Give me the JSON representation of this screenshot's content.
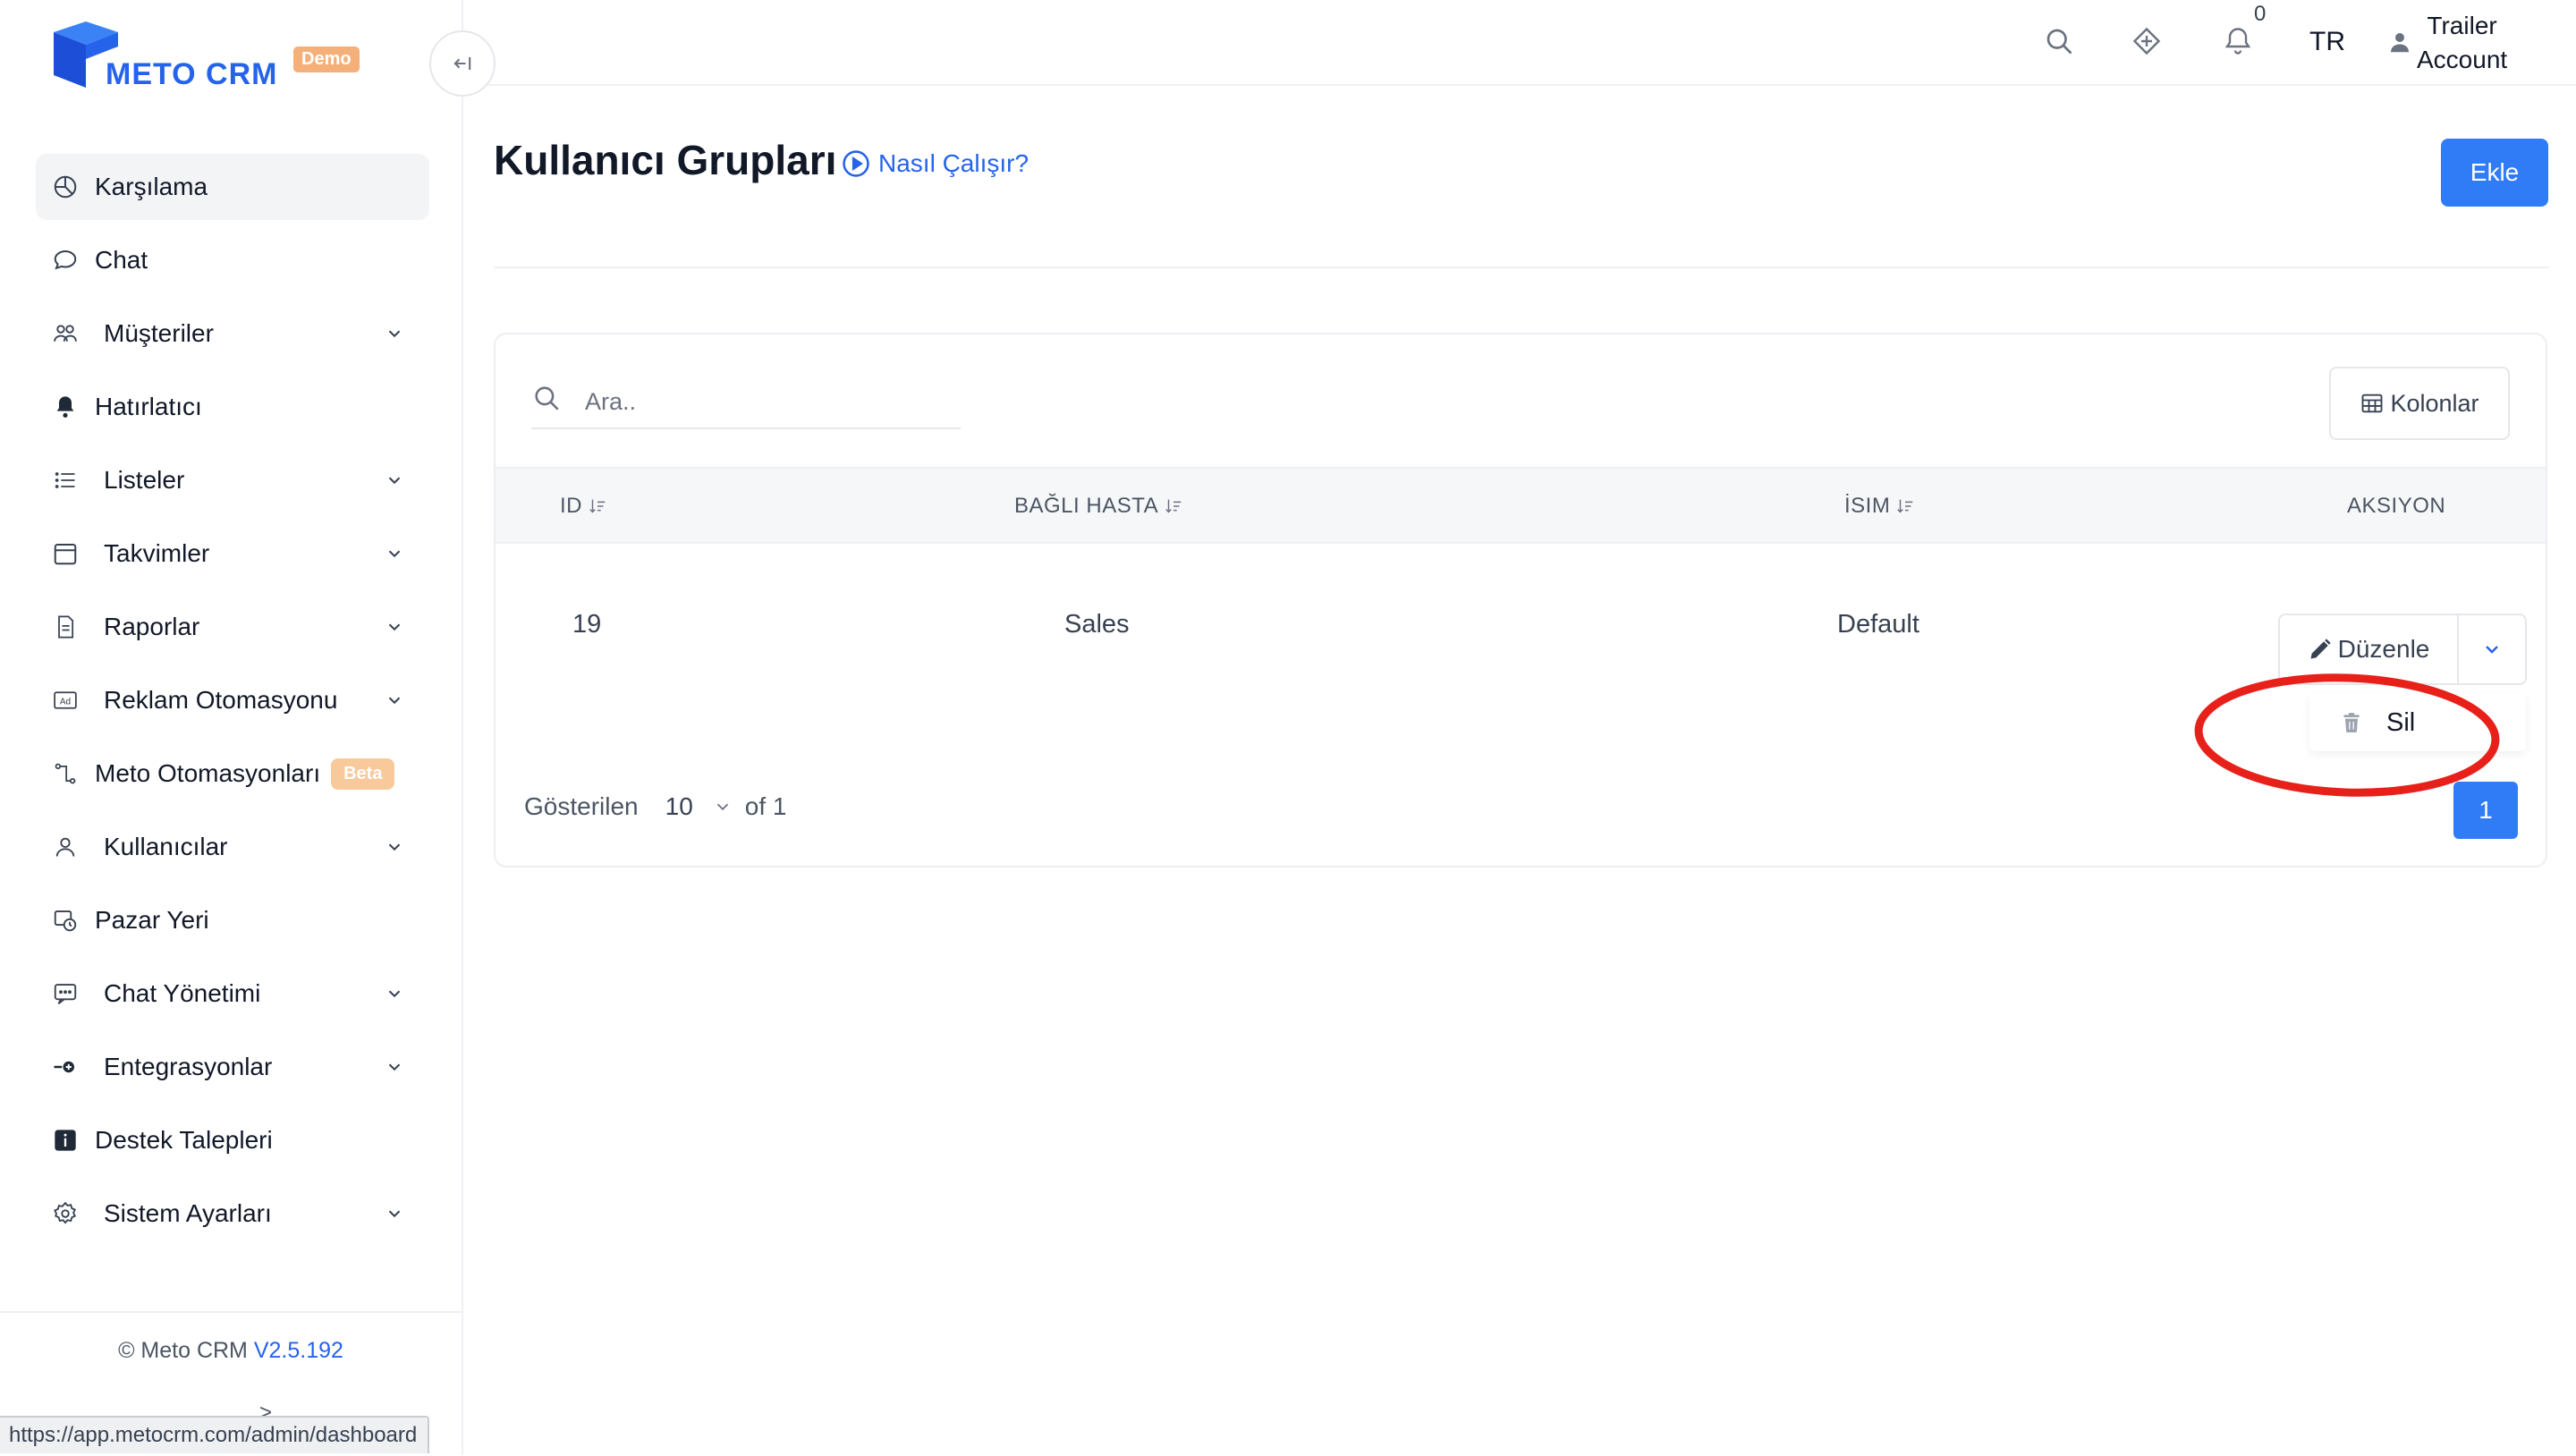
{
  "brand": {
    "name": "METO CRM",
    "badge": "Demo",
    "brand_color": "#2563eb"
  },
  "sidebar": {
    "items": [
      {
        "label": "Karşılama",
        "icon": "dashboard-icon",
        "active": true
      },
      {
        "label": "Chat",
        "icon": "chat-bubble-icon"
      },
      {
        "label": "Müşteriler",
        "icon": "users-icon",
        "submenu": true
      },
      {
        "label": "Hatırlatıcı",
        "icon": "bell-icon"
      },
      {
        "label": "Listeler",
        "icon": "list-icon",
        "submenu": true
      },
      {
        "label": "Takvimler",
        "icon": "calendar-icon",
        "submenu": true
      },
      {
        "label": "Raporlar",
        "icon": "report-icon",
        "submenu": true
      },
      {
        "label": "Reklam Otomasyonu",
        "icon": "ad-icon",
        "submenu": true
      },
      {
        "label": "Meto Otomasyonları",
        "icon": "automation-icon",
        "badge": "Beta"
      },
      {
        "label": "Kullanıcılar",
        "icon": "user-icon",
        "submenu": true
      },
      {
        "label": "Pazar Yeri",
        "icon": "marketplace-icon"
      },
      {
        "label": "Chat Yönetimi",
        "icon": "chat-manage-icon",
        "submenu": true
      },
      {
        "label": "Entegrasyonlar",
        "icon": "integration-icon",
        "submenu": true
      },
      {
        "label": "Destek Talepleri",
        "icon": "info-icon"
      },
      {
        "label": "Sistem Ayarları",
        "icon": "settings-gear-icon",
        "submenu": true
      }
    ],
    "footer": {
      "copyright": "© Meto CRM",
      "version": "V2.5.192"
    }
  },
  "status_bar": {
    "url": "https://app.metocrm.com/admin/dashboard"
  },
  "topbar": {
    "notification_count": "0",
    "language": "TR",
    "account_line1": "Trailer",
    "account_line2": "Account"
  },
  "page": {
    "title": "Kullanıcı Grupları",
    "help_link": "Nasıl Çalışır?",
    "add_button": "Ekle"
  },
  "table": {
    "search_placeholder": "Ara..",
    "columns_button": "Kolonlar",
    "headers": [
      "ID",
      "BAĞLI HASTA",
      "İSIM",
      "AKSIYON"
    ],
    "rows": [
      {
        "id": "19",
        "bagli_hasta": "Sales",
        "isim": "Default"
      }
    ],
    "action_edit": "Düzenle",
    "action_menu": [
      {
        "label": "Sil",
        "icon": "trash-icon"
      }
    ],
    "pagination": {
      "shown_label": "Gösterilen",
      "page_size": "10",
      "of_label": "of 1",
      "current_page": "1"
    }
  },
  "colors": {
    "primary": "#2f7cf6",
    "highlight": "#e8201a",
    "beta_badge": "#f8c99b",
    "demo_badge": "#f5b07a"
  }
}
